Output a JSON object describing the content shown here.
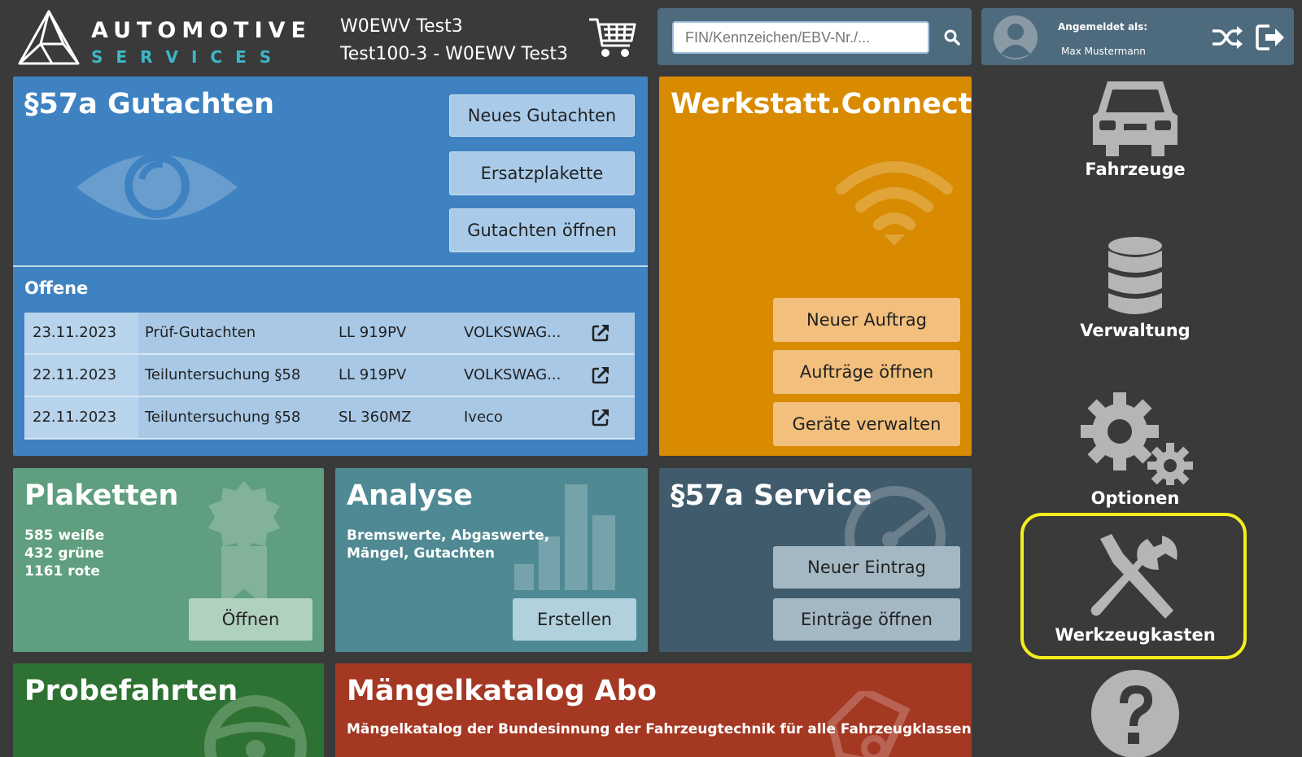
{
  "header": {
    "logo_line1": "AUTOMOTIVE",
    "logo_line2": "SERVICES",
    "vehicle_line1": "W0EWV Test3",
    "vehicle_line2": "Test100-3 - W0EWV Test3",
    "search_placeholder": "FIN/Kennzeichen/EBV-Nr./...",
    "login_label": "Angemeldet als:",
    "user_name": "Max Mustermann"
  },
  "gutachten": {
    "title": "§57a Gutachten",
    "buttons": [
      "Neues Gutachten",
      "Ersatzplakette",
      "Gutachten öffnen"
    ],
    "offene_label": "Offene",
    "rows": [
      {
        "date": "23.11.2023",
        "type": "Prüf-Gutachten",
        "plate": "LL 919PV",
        "make": "VOLKSWAG..."
      },
      {
        "date": "22.11.2023",
        "type": "Teiluntersuchung §58",
        "plate": "LL 919PV",
        "make": "VOLKSWAG..."
      },
      {
        "date": "22.11.2023",
        "type": "Teiluntersuchung §58",
        "plate": "SL 360MZ",
        "make": "Iveco"
      }
    ]
  },
  "werkstatt": {
    "title": "Werkstatt.Connect",
    "buttons": [
      "Neuer Auftrag",
      "Aufträge öffnen",
      "Geräte verwalten"
    ]
  },
  "plaketten": {
    "title": "Plaketten",
    "lines": [
      "585 weiße",
      "432 grüne",
      "1161 rote"
    ],
    "button": "Öffnen"
  },
  "analyse": {
    "title": "Analyse",
    "lines": [
      "Bremswerte, Abgaswerte,",
      "Mängel, Gutachten"
    ],
    "button": "Erstellen"
  },
  "service": {
    "title": "§57a Service",
    "buttons": [
      "Neuer Eintrag",
      "Einträge öffnen"
    ]
  },
  "probefahrten": {
    "title": "Probefahrten"
  },
  "maengel": {
    "title": "Mängelkatalog Abo",
    "subtitle": "Mängelkatalog der Bundesinnung der Fahrzeugtechnik für alle Fahrzeugklassen"
  },
  "nav": {
    "items": [
      {
        "label": "Fahrzeuge",
        "icon": "car-icon"
      },
      {
        "label": "Verwaltung",
        "icon": "database-icon"
      },
      {
        "label": "Optionen",
        "icon": "gears-icon"
      },
      {
        "label": "Werkzeugkasten",
        "icon": "tools-icon"
      },
      {
        "label": "",
        "icon": "help-icon"
      }
    ],
    "highlight_color": "#f4ef1c"
  },
  "colors": {
    "background": "#3a3a3a",
    "gutachten": "#3e82c1",
    "werkstatt": "#d88a00",
    "plaketten": "#5f9e7e",
    "analyse": "#4f8993",
    "service": "#405b6b",
    "probefahrten": "#2e7233",
    "maengel": "#a53823"
  }
}
